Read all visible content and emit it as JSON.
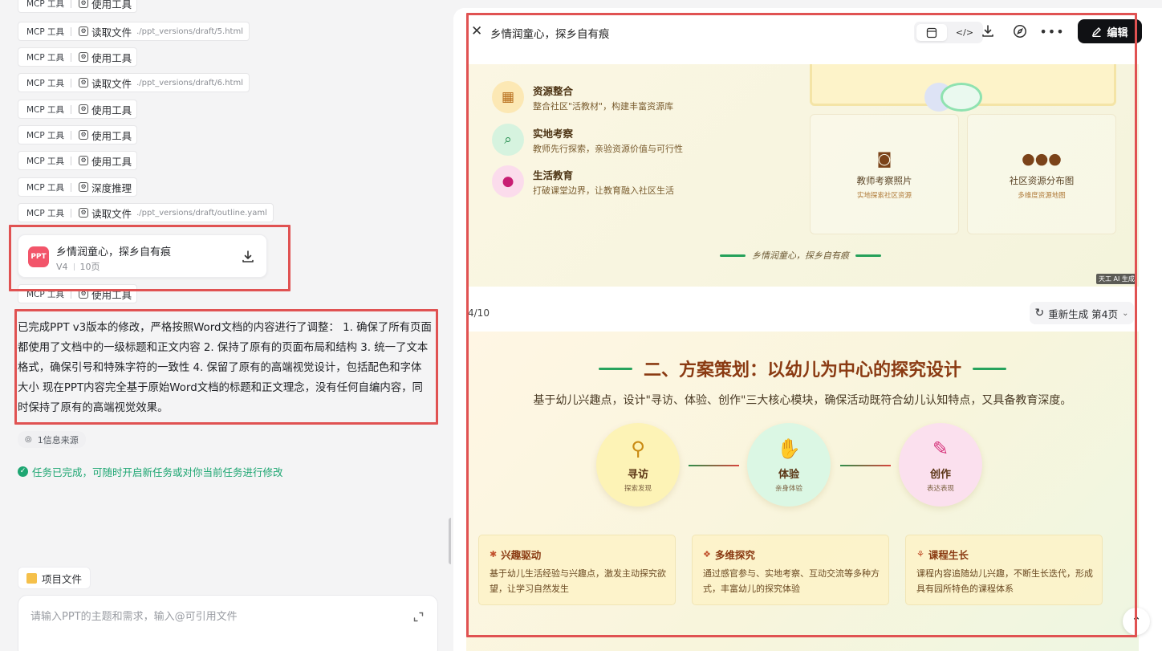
{
  "chat": {
    "tool_rows": [
      {
        "mcp": "MCP 工具",
        "action": "使用工具",
        "path": ""
      },
      {
        "mcp": "MCP 工具",
        "action": "读取文件",
        "path": "./ppt_versions/draft/5.html"
      },
      {
        "mcp": "MCP 工具",
        "action": "使用工具",
        "path": ""
      },
      {
        "mcp": "MCP 工具",
        "action": "读取文件",
        "path": "./ppt_versions/draft/6.html"
      },
      {
        "mcp": "MCP 工具",
        "action": "使用工具",
        "path": ""
      },
      {
        "mcp": "MCP 工具",
        "action": "使用工具",
        "path": ""
      },
      {
        "mcp": "MCP 工具",
        "action": "使用工具",
        "path": ""
      },
      {
        "mcp": "MCP 工具",
        "action": "深度推理",
        "path": ""
      },
      {
        "mcp": "MCP 工具",
        "action": "读取文件",
        "path": "./ppt_versions/draft/outline.yaml"
      },
      {
        "mcp": "MCP 工具",
        "action": "使用工具",
        "path": ""
      }
    ],
    "ppt_card": {
      "badge": "PPT",
      "title": "乡情润童心，探乡自有痕",
      "version": "V4",
      "pages": "10页"
    },
    "summary": "已完成PPT v3版本的修改，严格按照Word文档的内容进行了调整： 1. 确保了所有页面都使用了文档中的一级标题和正文内容 2. 保持了原有的页面布局和结构 3. 统一了文本格式，确保引号和特殊字符的一致性 4. 保留了原有的高端视觉设计，包括配色和字体大小 现在PPT内容完全基于原始Word文档的标题和正文理念，没有任何自编内容，同时保持了原有的高端视觉效果。",
    "source_chip": "1信息来源",
    "done_text": "任务已完成，可随时开启新任务或对你当前任务进行修改",
    "project_files": "项目文件",
    "input_placeholder": "请输入PPT的主题和需求，输入@可引用文件"
  },
  "preview": {
    "title": "乡情润童心，探乡自有痕",
    "edit_label": "编辑",
    "icons": [
      "close-icon",
      "preview-icon",
      "code-icon",
      "download-icon",
      "compass-icon",
      "more-icon",
      "pencil-icon"
    ],
    "page_indicator": "4/10",
    "regen_label": "重新生成 第4页",
    "slide3": {
      "features": [
        {
          "title": "资源整合",
          "desc": "整合社区\"活教材\"，构建丰富资源库",
          "icon": "map-icon",
          "bg": "#fce8b4"
        },
        {
          "title": "实地考察",
          "desc": "教师先行探索，亲验资源价值与可行性",
          "icon": "search-location-icon",
          "bg": "#d6f3df"
        },
        {
          "title": "生活教育",
          "desc": "打破课堂边界，让教育融入社区生活",
          "icon": "lightbulb-icon",
          "bg": "#fbdcec"
        }
      ],
      "cards": [
        {
          "title": "教师考察照片",
          "sub": "实地探索社区资源",
          "icon": "camera-icon"
        },
        {
          "title": "社区资源分布图",
          "sub": "多维度资源地图",
          "icon": "users-icon"
        }
      ],
      "footer": "乡情润童心，探乡自有痕",
      "watermark": "天工 AI 生成"
    },
    "slide4": {
      "title": "二、方案策划：以幼儿为中心的探究设计",
      "subtitle": "基于幼儿兴趣点，设计\"寻访、体验、创作\"三大核心模块，确保活动既符合幼儿认知特点，又具备教育深度。",
      "modules": [
        {
          "title": "寻访",
          "sub": "探索发现",
          "icon": "search-icon",
          "bg": "#fdf3b6",
          "color": "#c98a12"
        },
        {
          "title": "体验",
          "sub": "亲身体验",
          "icon": "hand-icon",
          "bg": "#dbf7e4",
          "color": "#1f8a4a"
        },
        {
          "title": "创作",
          "sub": "表达表现",
          "icon": "brush-icon",
          "bg": "#fbe0ee",
          "color": "#d6377d"
        }
      ],
      "blocks": [
        {
          "title": "兴趣驱动",
          "desc": "基于幼儿生活经验与兴趣点，激发主动探究欲望，让学习自然发生",
          "icon": "asterisk-icon"
        },
        {
          "title": "多维探究",
          "desc": "通过感官参与、实地考察、互动交流等多种方式，丰富幼儿的探究体验",
          "icon": "cubes-icon"
        },
        {
          "title": "课程生长",
          "desc": "课程内容追随幼儿兴趣，不断生长迭代，形成具有园所特色的课程体系",
          "icon": "seedling-icon"
        }
      ]
    }
  },
  "colors": {
    "accent_red": "#e05252",
    "edit_bg": "#101114",
    "done_green": "#1ea672",
    "divider_green": "#27a35d",
    "title_brown": "#8a3a12"
  }
}
